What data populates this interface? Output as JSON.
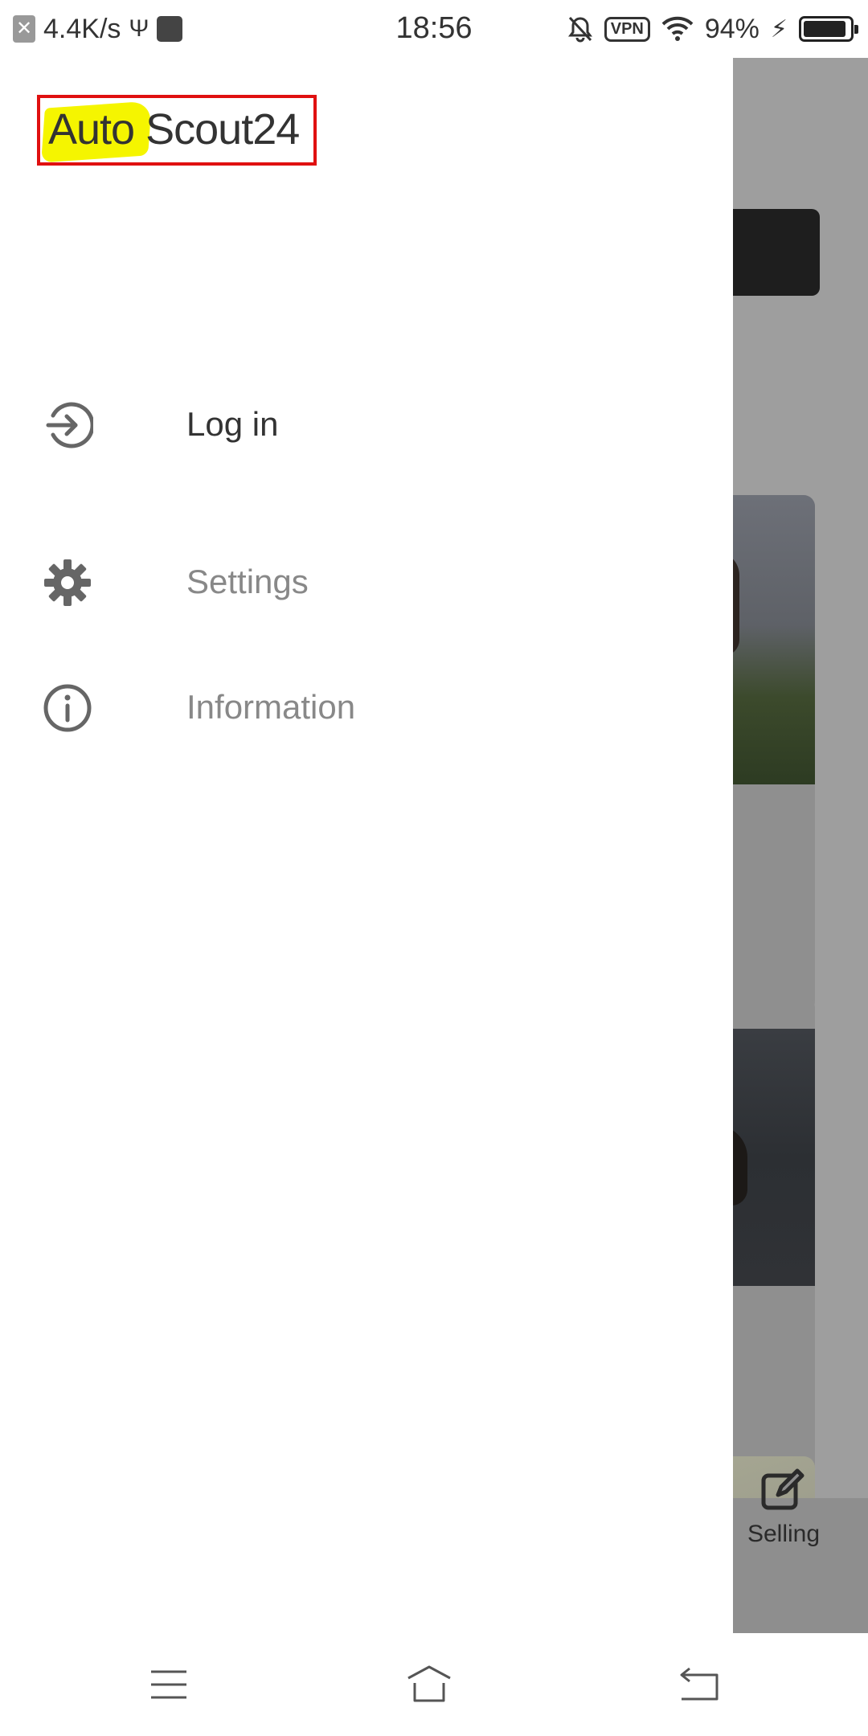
{
  "status_bar": {
    "net_speed": "4.4K/s",
    "time": "18:56",
    "vpn": "VPN",
    "battery_percent": "94%",
    "battery_level": 0.94
  },
  "app": {
    "logo_part1": "Auto",
    "logo_part2": "Scout24",
    "brand_highlight": "#f5f500",
    "focus_outline": "#e01010"
  },
  "drawer": {
    "items": [
      {
        "label": "Log in",
        "icon": "login-arrow-icon"
      },
      {
        "label": "Settings",
        "icon": "gear-icon"
      },
      {
        "label": "Information",
        "icon": "info-icon"
      }
    ]
  },
  "background": {
    "bottom_nav_label": "Selling"
  },
  "system_nav": {
    "buttons": [
      "menu-icon",
      "home-icon",
      "back-icon"
    ]
  }
}
